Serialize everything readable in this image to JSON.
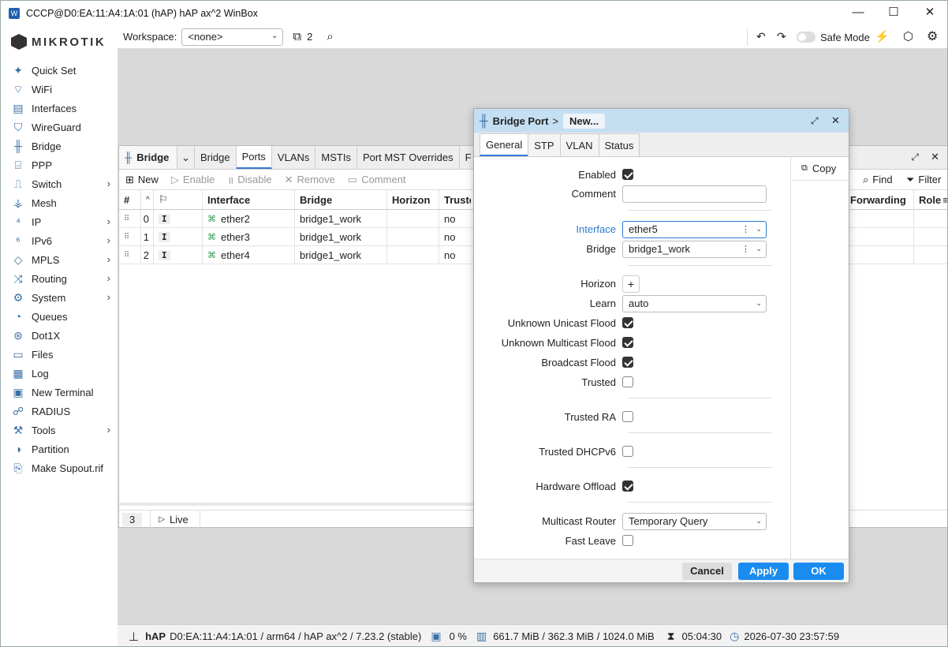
{
  "window": {
    "title": "CCCP@D0:EA:11:A4:1A:01 (hAP) hAP ax^2 WinBox"
  },
  "logo": {
    "text": "MIKROTIK"
  },
  "sidebar": {
    "items": [
      {
        "label": "Quick Set",
        "icon": "wand-icon",
        "glyph": "✦",
        "arrow": ""
      },
      {
        "label": "WiFi",
        "icon": "wifi-icon",
        "glyph": "⌔",
        "arrow": ""
      },
      {
        "label": "Interfaces",
        "icon": "interfaces-icon",
        "glyph": "▤",
        "arrow": ""
      },
      {
        "label": "WireGuard",
        "icon": "wireguard-icon",
        "glyph": "⛉",
        "arrow": ""
      },
      {
        "label": "Bridge",
        "icon": "bridge-icon",
        "glyph": "╫",
        "arrow": ""
      },
      {
        "label": "PPP",
        "icon": "ppp-icon",
        "glyph": "⌸",
        "arrow": ""
      },
      {
        "label": "Switch",
        "icon": "switch-icon",
        "glyph": "⎍",
        "arrow": "›"
      },
      {
        "label": "Mesh",
        "icon": "mesh-icon",
        "glyph": "⚶",
        "arrow": ""
      },
      {
        "label": "IP",
        "icon": "ip-icon",
        "glyph": "⁴",
        "arrow": "›"
      },
      {
        "label": "IPv6",
        "icon": "ipv6-icon",
        "glyph": "⁶",
        "arrow": "›"
      },
      {
        "label": "MPLS",
        "icon": "mpls-icon",
        "glyph": "◇",
        "arrow": "›"
      },
      {
        "label": "Routing",
        "icon": "routing-icon",
        "glyph": "⤨",
        "arrow": "›"
      },
      {
        "label": "System",
        "icon": "system-icon",
        "glyph": "⚙",
        "arrow": "›"
      },
      {
        "label": "Queues",
        "icon": "queues-icon",
        "glyph": "◔",
        "arrow": ""
      },
      {
        "label": "Dot1X",
        "icon": "dot1x-icon",
        "glyph": "⊛",
        "arrow": ""
      },
      {
        "label": "Files",
        "icon": "files-icon",
        "glyph": "▭",
        "arrow": ""
      },
      {
        "label": "Log",
        "icon": "log-icon",
        "glyph": "▦",
        "arrow": ""
      },
      {
        "label": "New Terminal",
        "icon": "terminal-icon",
        "glyph": "▣",
        "arrow": ""
      },
      {
        "label": "RADIUS",
        "icon": "radius-icon",
        "glyph": "☍",
        "arrow": ""
      },
      {
        "label": "Tools",
        "icon": "tools-icon",
        "glyph": "⚒",
        "arrow": "›"
      },
      {
        "label": "Partition",
        "icon": "partition-icon",
        "glyph": "◑",
        "arrow": ""
      },
      {
        "label": "Make Supout.rif",
        "icon": "supout-icon",
        "glyph": "⎘",
        "arrow": ""
      }
    ]
  },
  "toolbar": {
    "workspace_label": "Workspace:",
    "workspace_value": "<none>",
    "windows_count": "2",
    "safe_mode_label": "Safe Mode"
  },
  "bridge_window": {
    "title": "Bridge",
    "tabs": [
      "Bridge",
      "Ports",
      "VLANs",
      "MSTIs",
      "Port MST Overrides",
      "F"
    ],
    "active_tab": "Ports",
    "actions": {
      "new": "New",
      "enable": "Enable",
      "disable": "Disable",
      "remove": "Remove",
      "comment": "Comment",
      "find": "Find",
      "filter": "Filter"
    },
    "columns": {
      "num": "#",
      "interface": "Interface",
      "bridge": "Bridge",
      "horizon": "Horizon",
      "trusted": "Truste",
      "forwarding": "Forwarding",
      "role": "Role"
    },
    "rows": [
      {
        "num": "0",
        "flag": "I",
        "interface": "ether2",
        "bridge": "bridge1_work",
        "horizon": "",
        "trusted": "no"
      },
      {
        "num": "1",
        "flag": "I",
        "interface": "ether3",
        "bridge": "bridge1_work",
        "horizon": "",
        "trusted": "no"
      },
      {
        "num": "2",
        "flag": "I",
        "interface": "ether4",
        "bridge": "bridge1_work",
        "horizon": "",
        "trusted": "no"
      }
    ],
    "footer": {
      "count": "3",
      "live": "Live"
    }
  },
  "dialog": {
    "title": "Bridge Port",
    "crumb_sep": ">",
    "crumb": "New...",
    "tabs": [
      "General",
      "STP",
      "VLAN",
      "Status"
    ],
    "copy_label": "Copy",
    "fields": {
      "enabled": "Enabled",
      "comment": "Comment",
      "comment_value": "",
      "interface": "Interface",
      "interface_value": "ether5",
      "bridge": "Bridge",
      "bridge_value": "bridge1_work",
      "horizon": "Horizon",
      "learn": "Learn",
      "learn_value": "auto",
      "unknown_unicast": "Unknown Unicast Flood",
      "unknown_multicast": "Unknown Multicast Flood",
      "broadcast": "Broadcast Flood",
      "trusted": "Trusted",
      "trusted_ra": "Trusted RA",
      "trusted_dhcpv6": "Trusted DHCPv6",
      "hw_offload": "Hardware Offload",
      "multicast_router": "Multicast Router",
      "multicast_router_value": "Temporary Query",
      "fast_leave": "Fast Leave"
    },
    "buttons": {
      "cancel": "Cancel",
      "apply": "Apply",
      "ok": "OK"
    }
  },
  "statusbar": {
    "board": "hAP",
    "info": "D0:EA:11:A4:1A:01 / arm64 / hAP ax^2 / 7.23.2 (stable)",
    "cpu": "0 %",
    "memory": "661.7 MiB / 362.3 MiB / 1024.0 MiB",
    "uptime": "05:04:30",
    "datetime": "2026-07-30 23:57:59"
  },
  "colors": {
    "accent": "#1a8cf0",
    "title_blue": "#c5dff2",
    "link_blue": "#2b7bd0"
  }
}
